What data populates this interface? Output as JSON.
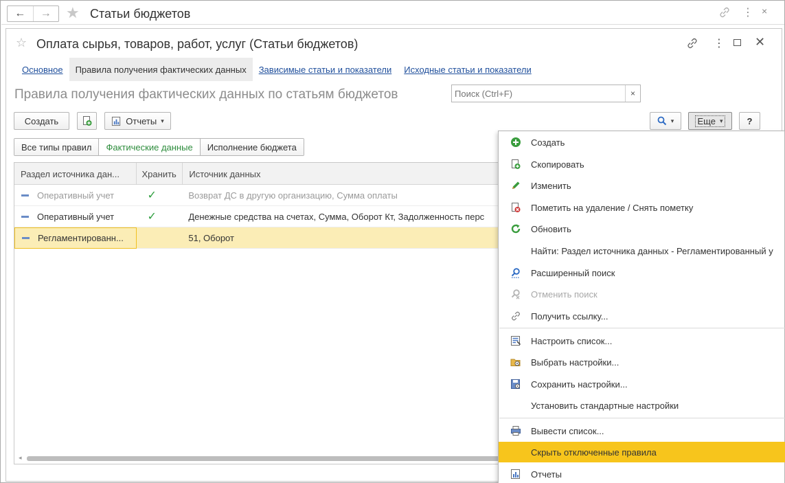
{
  "app": {
    "title": "Статьи бюджетов",
    "back_glyph": "←",
    "forward_glyph": "→",
    "star_glyph": "★",
    "more_glyph": "⋮",
    "close_glyph": "×"
  },
  "form": {
    "title": "Оплата сырья, товаров, работ, услуг (Статьи бюджетов)",
    "star_glyph": "☆",
    "more_glyph": "⋮",
    "close_glyph": "✕",
    "tabs": [
      {
        "label": "Основное",
        "active": false
      },
      {
        "label": "Правила получения фактических данных",
        "active": true
      },
      {
        "label": "Зависимые статьи и показатели",
        "active": false
      },
      {
        "label": "Исходные статьи и показатели",
        "active": false
      }
    ],
    "section_title": "Правила получения фактических данных по статьям бюджетов"
  },
  "toolbar": {
    "create_label": "Создать",
    "reports_label": "Отчеты",
    "search_placeholder": "Поиск (Ctrl+F)",
    "search_clear_glyph": "×",
    "more_label": "Еще",
    "help_label": "?",
    "caret_glyph": "▾"
  },
  "filters": [
    {
      "label": "Все типы правил",
      "active": false
    },
    {
      "label": "Фактические данные",
      "active": true
    },
    {
      "label": "Исполнение бюджета",
      "active": false
    }
  ],
  "table": {
    "columns": [
      "Раздел источника дан...",
      "Хранить",
      "Источник данных"
    ],
    "rows": [
      {
        "section": "Оперативный учет",
        "store": "✓",
        "source": "Возврат ДС в другую организацию, Сумма оплаты",
        "state": "grey"
      },
      {
        "section": "Оперативный учет",
        "store": "✓",
        "source": "Денежные средства на счетах, Сумма, Оборот Кт, Задолженность перс",
        "state": "normal"
      },
      {
        "section": "Регламентированн...",
        "store": "",
        "source": "51, Оборот",
        "state": "selected"
      }
    ],
    "scroll_left_glyph": "◂"
  },
  "menu": {
    "items": [
      {
        "label": "Создать",
        "icon": "plus-circle-icon",
        "state": "normal"
      },
      {
        "label": "Скопировать",
        "icon": "copy-icon",
        "state": "normal"
      },
      {
        "label": "Изменить",
        "icon": "pencil-icon",
        "state": "normal"
      },
      {
        "label": "Пометить на удаление / Снять пометку",
        "icon": "delete-mark-icon",
        "state": "normal"
      },
      {
        "label": "Обновить",
        "icon": "refresh-icon",
        "state": "normal"
      },
      {
        "label": "Найти: Раздел источника данных - Регламентированный у",
        "icon": "",
        "state": "normal"
      },
      {
        "label": "Расширенный поиск",
        "icon": "advanced-search-icon",
        "state": "normal"
      },
      {
        "label": "Отменить поиск",
        "icon": "cancel-search-icon",
        "state": "disabled"
      },
      {
        "label": "Получить ссылку...",
        "icon": "link-icon",
        "state": "normal"
      },
      {
        "label": "Настроить список...",
        "icon": "list-settings-icon",
        "state": "normal"
      },
      {
        "label": "Выбрать настройки...",
        "icon": "open-settings-icon",
        "state": "normal"
      },
      {
        "label": "Сохранить настройки...",
        "icon": "save-settings-icon",
        "state": "normal"
      },
      {
        "label": "Установить стандартные настройки",
        "icon": "",
        "state": "normal"
      },
      {
        "label": "Вывести список...",
        "icon": "print-list-icon",
        "state": "normal"
      },
      {
        "label": "Скрыть отключенные правила",
        "icon": "",
        "state": "highlighted"
      },
      {
        "label": "Отчеты",
        "icon": "reports-icon",
        "state": "normal"
      }
    ]
  },
  "colors": {
    "accent_green": "#2d8c3c",
    "link_blue": "#1f4f9c",
    "selection_row": "#fbedb6",
    "menu_highlight": "#f7c51c"
  }
}
